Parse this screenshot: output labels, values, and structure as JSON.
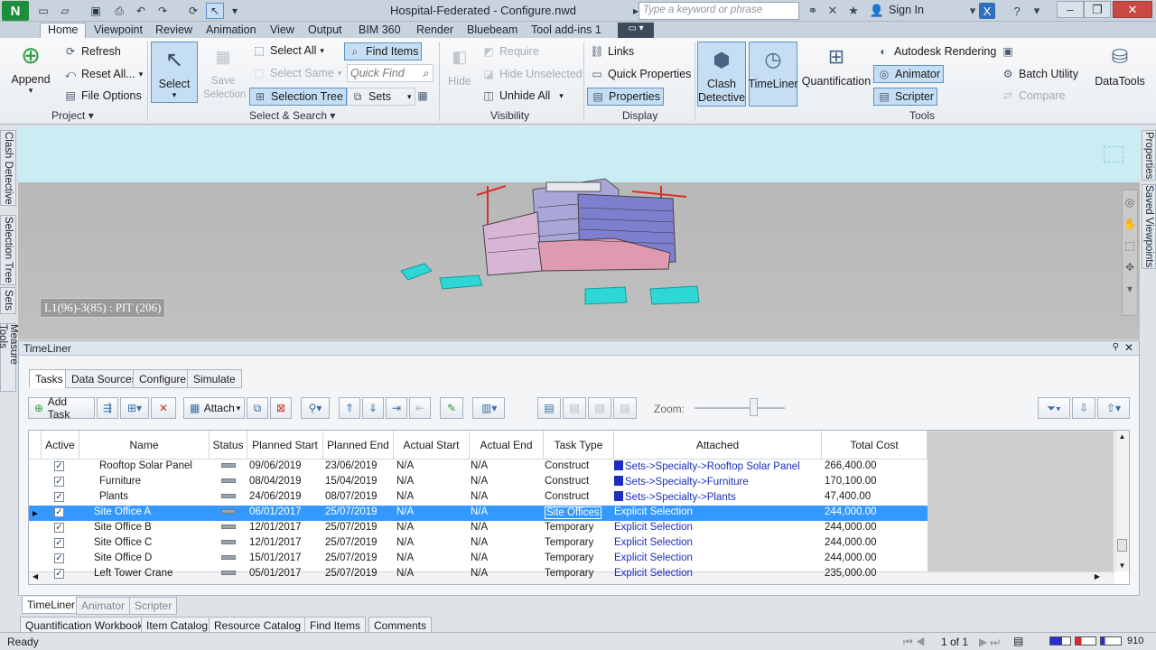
{
  "window": {
    "title": "Hospital-Federated - Configure.nwd",
    "search_placeholder": "Type a keyword or phrase",
    "sign_in": "Sign In",
    "tab_addins": "Tool add-ins 1"
  },
  "menu": {
    "tabs": [
      "Home",
      "Viewpoint",
      "Review",
      "Animation",
      "View",
      "Output",
      "BIM 360",
      "Render",
      "Bluebeam",
      "Tool add-ins 1"
    ]
  },
  "ribbon": {
    "project": {
      "append": "Append",
      "refresh": "Refresh",
      "reset_all": "Reset All...",
      "file_options": "File Options",
      "label": "Project"
    },
    "select_search": {
      "select": "Select",
      "save_selection": "Save Selection",
      "select_all": "Select All",
      "select_same": "Select Same",
      "selection_tree": "Selection Tree",
      "find_items": "Find Items",
      "quick_find": "Quick Find",
      "sets": "Sets",
      "label": "Select & Search"
    },
    "visibility": {
      "hide": "Hide",
      "require": "Require",
      "hide_unselected": "Hide Unselected",
      "unhide_all": "Unhide All",
      "label": "Visibility"
    },
    "display": {
      "links": "Links",
      "quick_properties": "Quick Properties",
      "properties": "Properties",
      "label": "Display"
    },
    "tools": {
      "clash_detective": "Clash Detective",
      "timeliner": "TimeLiner",
      "quantification": "Quantification",
      "autodesk_rendering": "Autodesk Rendering",
      "animator": "Animator",
      "scripter": "Scripter",
      "batch_utility": "Batch Utility",
      "compare": "Compare",
      "datatools": "DataTools",
      "label": "Tools"
    }
  },
  "left_panels": [
    "Clash Detective",
    "Selection Tree",
    "Sets",
    "Measure Tools"
  ],
  "right_panels": [
    "Properties",
    "Saved Viewpoints"
  ],
  "viewport": {
    "readout": "L1(96)-3(85) : PIT (206)"
  },
  "timeliner": {
    "title": "TimeLiner",
    "tabs": [
      "Tasks",
      "Data Sources",
      "Configure",
      "Simulate"
    ],
    "toolbar": {
      "add_task": "Add Task",
      "attach": "Attach",
      "zoom": "Zoom:"
    },
    "columns": [
      "Active",
      "Name",
      "Status",
      "Planned Start",
      "Planned End",
      "Actual Start",
      "Actual End",
      "Task Type",
      "Attached",
      "Total Cost"
    ],
    "rows": [
      {
        "name": "Rooftop Solar Panel",
        "ps": "09/06/2019",
        "pe": "23/06/2019",
        "as": "N/A",
        "ae": "N/A",
        "type": "Construct",
        "att": "Sets->Specialty->Rooftop Solar Panel",
        "cost": "266,400.00"
      },
      {
        "name": "Furniture",
        "ps": "08/04/2019",
        "pe": "15/04/2019",
        "as": "N/A",
        "ae": "N/A",
        "type": "Construct",
        "att": "Sets->Specialty->Furniture",
        "cost": "170,100.00"
      },
      {
        "name": "Plants",
        "ps": "24/06/2019",
        "pe": "08/07/2019",
        "as": "N/A",
        "ae": "N/A",
        "type": "Construct",
        "att": "Sets->Specialty->Plants",
        "cost": "47,400.00"
      },
      {
        "name": "Site Office A",
        "ps": "06/01/2017",
        "pe": "25/07/2019",
        "as": "N/A",
        "ae": "N/A",
        "type": "Site Offices",
        "att": "Explicit Selection",
        "cost": "244,000.00"
      },
      {
        "name": "Site Office B",
        "ps": "12/01/2017",
        "pe": "25/07/2019",
        "as": "N/A",
        "ae": "N/A",
        "type": "Temporary",
        "att": "Explicit Selection",
        "cost": "244,000.00"
      },
      {
        "name": "Site Office C",
        "ps": "12/01/2017",
        "pe": "25/07/2019",
        "as": "N/A",
        "ae": "N/A",
        "type": "Temporary",
        "att": "Explicit Selection",
        "cost": "244,000.00"
      },
      {
        "name": "Site Office D",
        "ps": "15/01/2017",
        "pe": "25/07/2019",
        "as": "N/A",
        "ae": "N/A",
        "type": "Temporary",
        "att": "Explicit Selection",
        "cost": "244,000.00"
      },
      {
        "name": "Left Tower Crane",
        "ps": "05/01/2017",
        "pe": "25/07/2019",
        "as": "N/A",
        "ae": "N/A",
        "type": "Temporary",
        "att": "Explicit Selection",
        "cost": "235,000.00"
      }
    ]
  },
  "bottom_tabs": [
    "TimeLiner",
    "Animator",
    "Scripter"
  ],
  "bottom_tabs2": [
    "Quantification Workbook",
    "Item Catalog",
    "Resource Catalog",
    "Find Items",
    "Comments"
  ],
  "status": {
    "ready": "Ready",
    "page": "1 of 1",
    "mem": "910"
  }
}
